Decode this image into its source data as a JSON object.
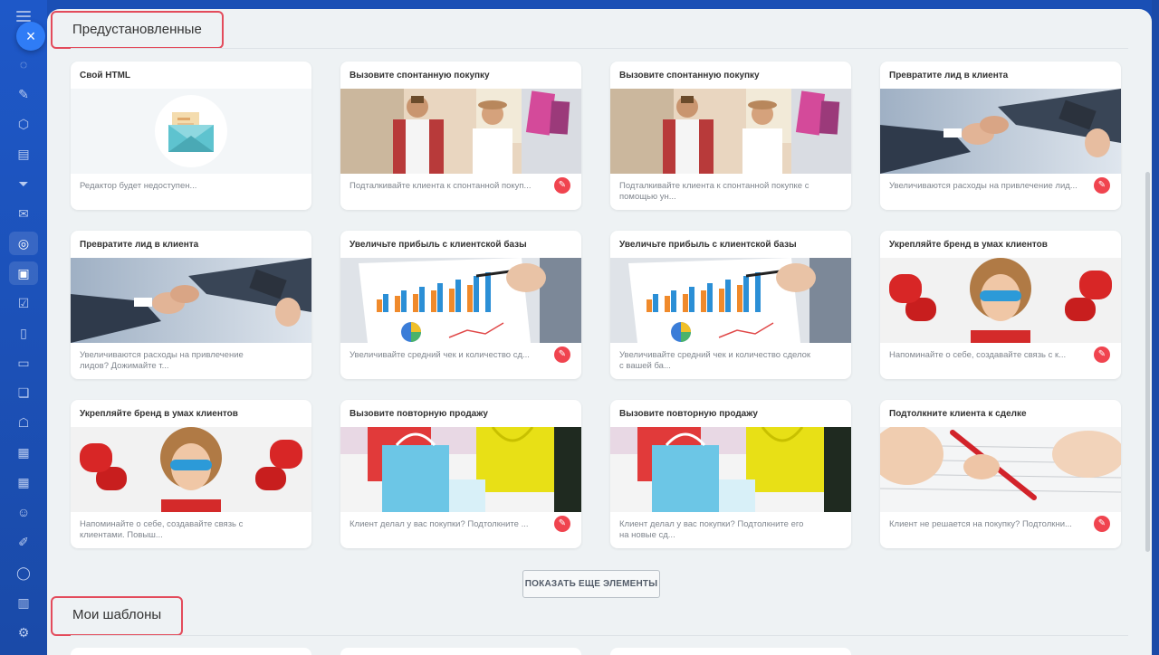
{
  "colors": {
    "accent": "#e34b5b",
    "app_bar": "#1a4fb5",
    "panel_bg": "#eef2f4",
    "card_action": "#f0444f"
  },
  "nav": {
    "close_icon": "×",
    "rail_icons": [
      "chat-icon",
      "edit-icon",
      "shield-icon",
      "document-icon",
      "filter-icon",
      "mail-icon",
      "target-icon",
      "marketing-icon",
      "checkbox-icon",
      "page-icon",
      "card-icon",
      "chat-bubbles-icon",
      "robot-icon",
      "calendar-icon",
      "calendar-2-icon",
      "contacts-icon",
      "pen-icon",
      "circle-icon",
      "id-card-icon",
      "settings-icon"
    ]
  },
  "sections": {
    "preinstalled": "Предустановленные",
    "my_templates": "Мои шаблоны"
  },
  "show_more": "ПОКАЗАТЬ ЕЩЕ ЭЛЕМЕНТЫ",
  "cards": [
    {
      "title": "Свой HTML",
      "desc": "Редактор будет недоступен...",
      "image": "html-envelope",
      "action": false
    },
    {
      "title": "Вызовите спонтанную покупку",
      "desc": "Подталкивайте клиента к спонтанной покуп...",
      "image": "shoppers",
      "action": true
    },
    {
      "title": "Вызовите спонтанную покупку",
      "desc": "Подталкивайте клиента к спонтанной покупке с помощью ун...",
      "image": "shoppers",
      "action": false
    },
    {
      "title": "Превратите лид в клиента",
      "desc": "Увеличиваются расходы на привлечение лид...",
      "image": "handshake",
      "action": true
    },
    {
      "title": "Превратите лид в клиента",
      "desc": "Увеличиваются расходы на привлечение лидов? Дожимайте т...",
      "image": "handshake",
      "action": false
    },
    {
      "title": "Увеличьте прибыль с клиентской базы",
      "desc": "Увеличивайте средний чек и количество сд...",
      "image": "report",
      "action": true
    },
    {
      "title": "Увеличьте прибыль с клиентской базы",
      "desc": "Увеличивайте средний чек и количество сделок с вашей ба...",
      "image": "report",
      "action": false
    },
    {
      "title": "Укрепляйте бренд в умах клиентов",
      "desc": "Напоминайте о себе, создавайте связь с к...",
      "image": "hero-kid",
      "action": true
    },
    {
      "title": "Укрепляйте бренд в умах клиентов",
      "desc": "Напоминайте о себе, создавайте связь с клиентами. Повыш...",
      "image": "hero-kid",
      "action": false
    },
    {
      "title": "Вызовите повторную продажу",
      "desc": "Клиент делал у вас покупки? Подтолкните ...",
      "image": "bags",
      "action": true
    },
    {
      "title": "Вызовите повторную продажу",
      "desc": "Клиент делал у вас покупки? Подтолкните его на новые сд...",
      "image": "bags",
      "action": false
    },
    {
      "title": "Подтолкните клиента к сделке",
      "desc": "Клиент не решается на покупку? Подтолкни...",
      "image": "signing",
      "action": true
    }
  ]
}
